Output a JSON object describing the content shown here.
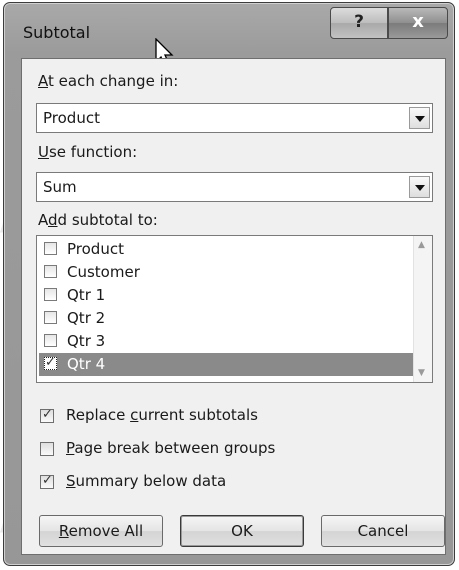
{
  "dialog": {
    "title": "Subtotal",
    "help_glyph": "?",
    "close_glyph": "x"
  },
  "group_by": {
    "label_accel": "A",
    "label_rest": "t each change in:",
    "value": "Product"
  },
  "function": {
    "label_accel": "U",
    "label_rest": "se function:",
    "value": "Sum"
  },
  "add_to": {
    "label_pre": "A",
    "label_accel": "d",
    "label_rest": "d subtotal to:",
    "items": [
      {
        "label": "Product",
        "checked": false,
        "selected": false
      },
      {
        "label": "Customer",
        "checked": false,
        "selected": false
      },
      {
        "label": "Qtr 1",
        "checked": false,
        "selected": false
      },
      {
        "label": "Qtr 2",
        "checked": false,
        "selected": false
      },
      {
        "label": "Qtr 3",
        "checked": false,
        "selected": false
      },
      {
        "label": "Qtr 4",
        "checked": true,
        "selected": true
      }
    ]
  },
  "options": {
    "replace": {
      "pre": "Replace ",
      "accel": "c",
      "rest": "urrent subtotals",
      "checked": true
    },
    "page_break": {
      "pre": "",
      "accel": "P",
      "rest": "age break between groups",
      "checked": false
    },
    "summary": {
      "pre": "",
      "accel": "S",
      "rest": "ummary below data",
      "checked": true
    }
  },
  "buttons": {
    "remove_accel": "R",
    "remove_rest": "emove All",
    "ok": "OK",
    "cancel": "Cancel"
  }
}
